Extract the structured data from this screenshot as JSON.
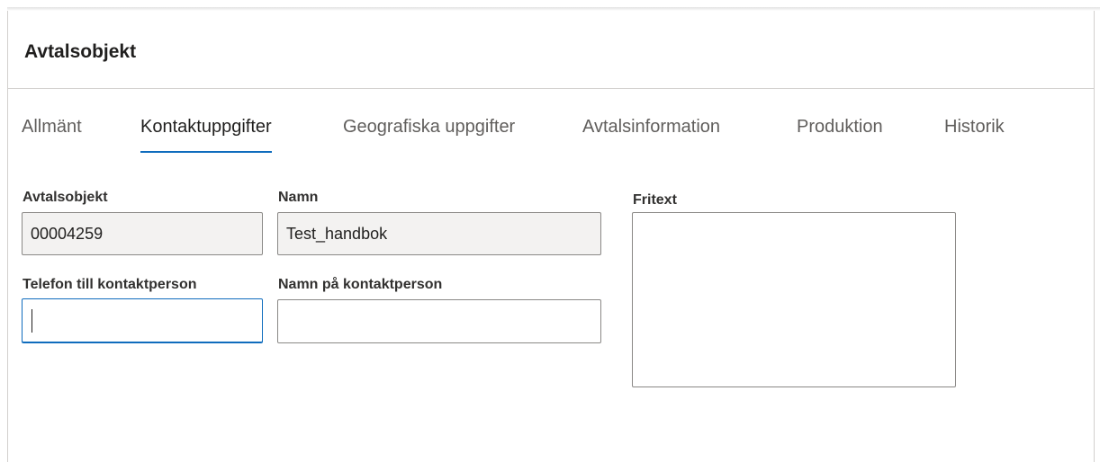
{
  "header": {
    "title": "Avtalsobjekt"
  },
  "tabs": [
    {
      "label": "Allmänt",
      "active": false
    },
    {
      "label": "Kontaktuppgifter",
      "active": true
    },
    {
      "label": "Geografiska uppgifter",
      "active": false
    },
    {
      "label": "Avtalsinformation",
      "active": false
    },
    {
      "label": "Produktion",
      "active": false
    },
    {
      "label": "Historik",
      "active": false
    }
  ],
  "form": {
    "avtalsobjekt": {
      "label": "Avtalsobjekt",
      "value": "00004259"
    },
    "namn": {
      "label": "Namn",
      "value": "Test_handbok"
    },
    "telefon": {
      "label": "Telefon till kontaktperson",
      "value": ""
    },
    "kontaktnamn": {
      "label": "Namn på kontaktperson",
      "value": ""
    },
    "fritext": {
      "label": "Fritext",
      "value": ""
    }
  },
  "colors": {
    "accent": "#0f6cbd",
    "readonly_bg": "#f3f2f1",
    "border": "#8a8886"
  }
}
